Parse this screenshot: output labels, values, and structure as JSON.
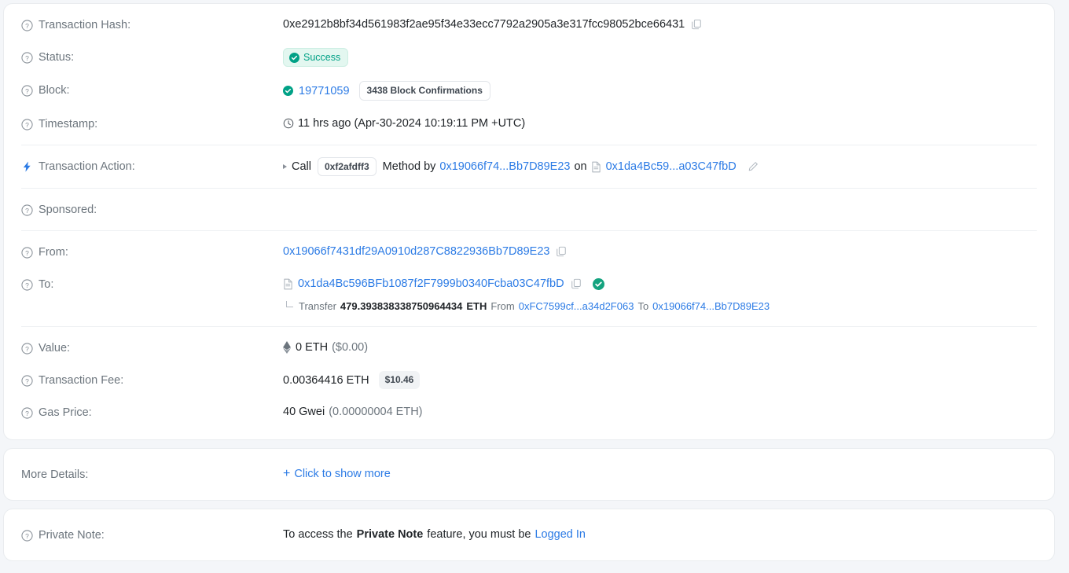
{
  "colors": {
    "accent": "#2c7be5",
    "success": "#00a186",
    "success_bg": "#e3f7f0",
    "label": "#6c757d",
    "page_bg": "#f4f6f9"
  },
  "main_card": {
    "transaction_hash": {
      "label": "Transaction Hash:",
      "value": "0xe2912b8bf34d561983f2ae95f34e33ecc7792a2905a3e317fcc98052bce66431",
      "copy_icon": "copy-icon",
      "help_icon": "question-circle-icon"
    },
    "status": {
      "label": "Status:",
      "badge": "Success",
      "badge_icon": "check-circle-icon",
      "help_icon": "question-circle-icon"
    },
    "block": {
      "label": "Block:",
      "number": "19771059",
      "confirmations": "3438 Block Confirmations",
      "status_icon": "check-circle-icon",
      "help_icon": "question-circle-icon"
    },
    "timestamp": {
      "label": "Timestamp:",
      "value": "11 hrs ago (Apr-30-2024 10:19:11 PM +UTC)",
      "clock_icon": "clock-icon",
      "help_icon": "question-circle-icon"
    },
    "transaction_action": {
      "label": "Transaction Action:",
      "bolt_icon": "lightning-bolt-icon",
      "call_text": "Call",
      "method_id": "0xf2afdff3",
      "method_by_text": "Method by",
      "caller_address": "0x19066f74...Bb7D89E23",
      "on_text": "on",
      "contract_address": "0x1da4Bc59...a03C47fbD",
      "contract_icon": "contract-document-icon",
      "edit_icon": "pencil-edit-icon"
    },
    "sponsored": {
      "label": "Sponsored:",
      "value": "",
      "help_icon": "question-circle-icon"
    },
    "from": {
      "label": "From:",
      "address": "0x19066f7431df29A0910d287C8822936Bb7D89E23",
      "copy_icon": "copy-icon",
      "help_icon": "question-circle-icon"
    },
    "to": {
      "label": "To:",
      "address": "0x1da4Bc596BFb1087f2F7999b0340Fcba03C47fbD",
      "contract_icon": "contract-document-icon",
      "copy_icon": "copy-icon",
      "verified_icon": "verified-check-icon",
      "help_icon": "question-circle-icon",
      "transfer": {
        "transfer_text": "Transfer",
        "amount": "479.393838338750964434",
        "currency": "ETH",
        "from_text": "From",
        "from_address": "0xFC7599cf...a34d2F063",
        "to_text": "To",
        "to_address": "0x19066f74...Bb7D89E23"
      }
    },
    "value": {
      "label": "Value:",
      "eth_icon": "ethereum-diamond-icon",
      "amount": "0 ETH",
      "fiat": "($0.00)",
      "help_icon": "question-circle-icon"
    },
    "transaction_fee": {
      "label": "Transaction Fee:",
      "amount": "0.00364416 ETH",
      "fiat_badge": "$10.46",
      "help_icon": "question-circle-icon"
    },
    "gas_price": {
      "label": "Gas Price:",
      "gwei": "40 Gwei",
      "eth": "(0.00000004 ETH)",
      "help_icon": "question-circle-icon"
    }
  },
  "more_details_card": {
    "label": "More Details:",
    "toggle_text": "Click to show more",
    "plus_icon": "plus-icon"
  },
  "private_note_card": {
    "label": "Private Note:",
    "help_icon": "question-circle-icon",
    "text_before": "To access the",
    "text_bold": "Private Note",
    "text_middle": "feature, you must be",
    "link": "Logged In"
  }
}
